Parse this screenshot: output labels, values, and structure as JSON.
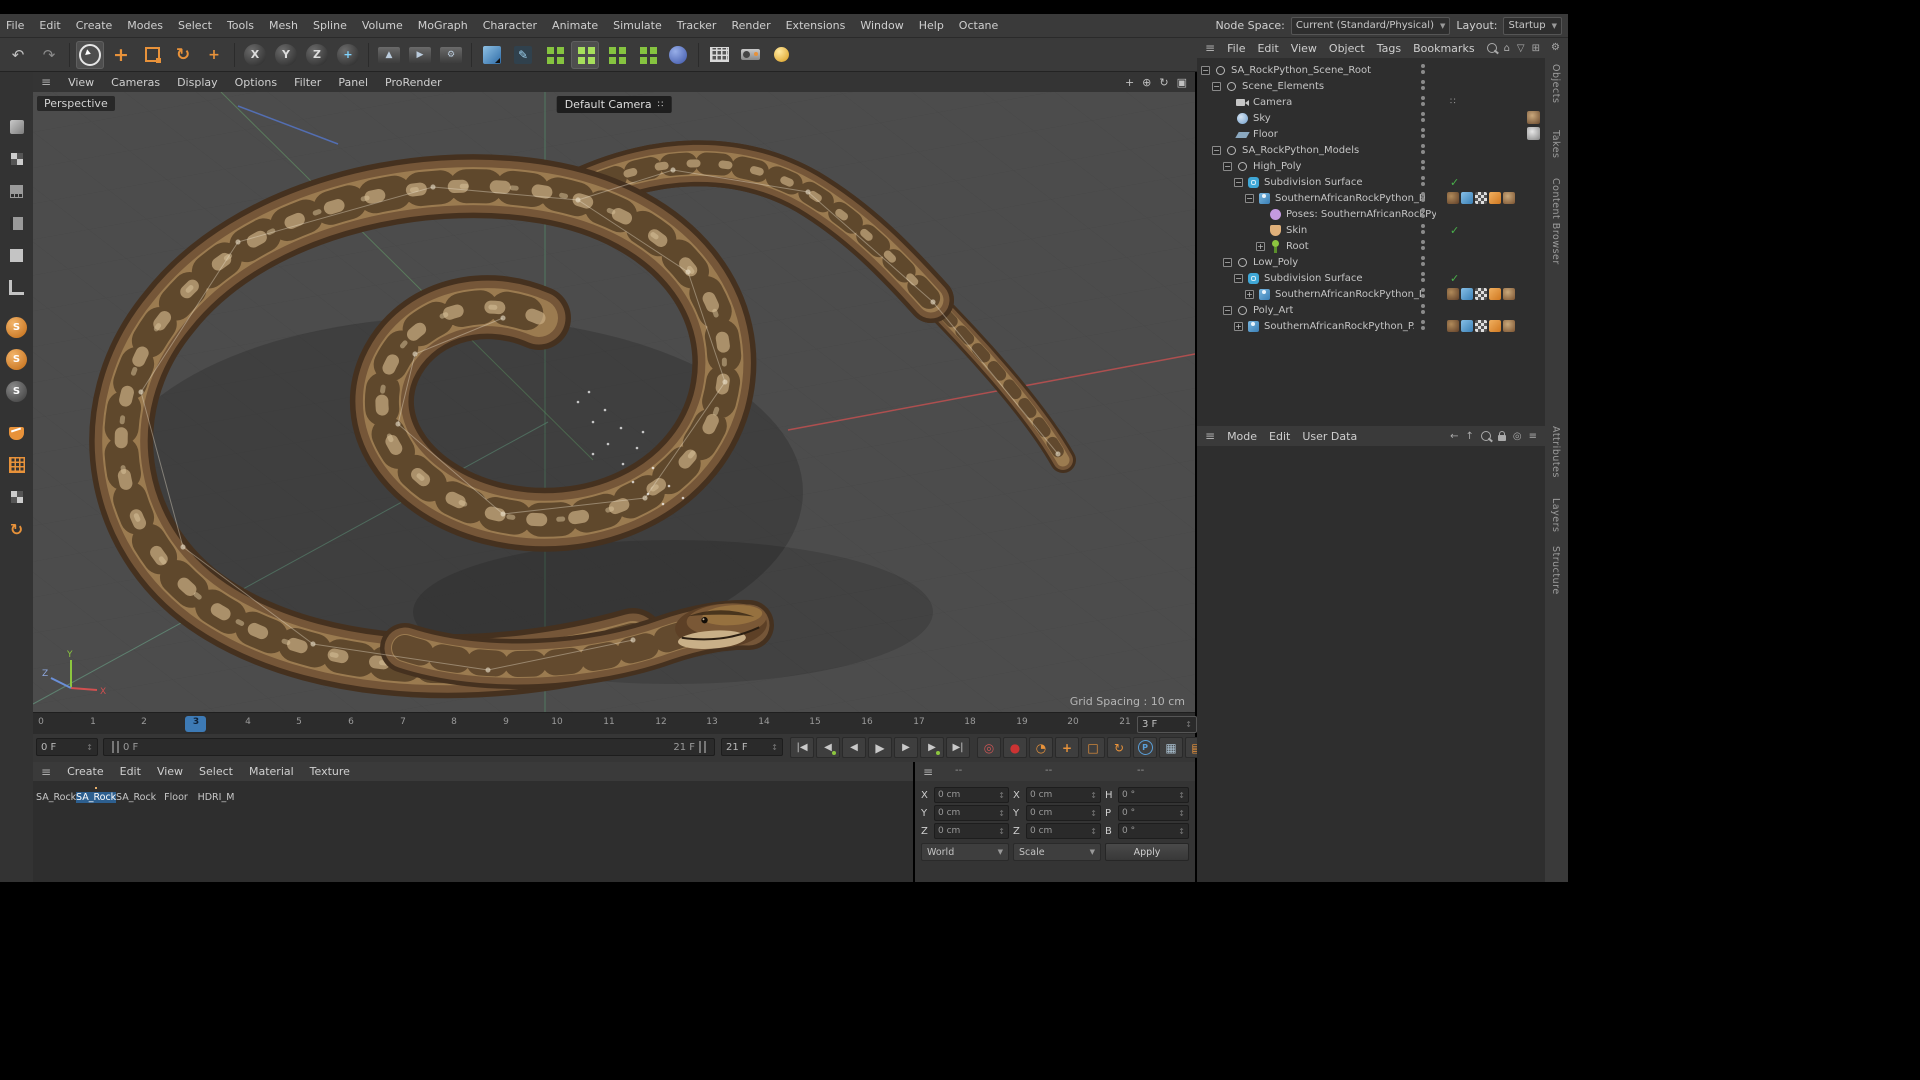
{
  "colors": {
    "accent_orange": "#e8923a",
    "accent_blue": "#4a8fd0",
    "selection_blue": "#2d5f8f",
    "check_green": "#49b04a"
  },
  "menubar": {
    "items": [
      "File",
      "Edit",
      "Create",
      "Modes",
      "Select",
      "Tools",
      "Mesh",
      "Spline",
      "Volume",
      "MoGraph",
      "Character",
      "Animate",
      "Simulate",
      "Tracker",
      "Render",
      "Extensions",
      "Window",
      "Help",
      "Octane"
    ],
    "node_space_label": "Node Space:",
    "node_space_value": "Current (Standard/Physical)",
    "layout_label": "Layout:",
    "layout_value": "Startup"
  },
  "toolbar": {
    "axis_x": "X",
    "axis_y": "Y",
    "axis_z": "Z"
  },
  "viewport": {
    "menu": [
      "View",
      "Cameras",
      "Display",
      "Options",
      "Filter",
      "Panel",
      "ProRender"
    ],
    "view_label": "Perspective",
    "camera_label": "Default Camera",
    "grid_spacing": "Grid Spacing : 10 cm",
    "axis_x": "X",
    "axis_y": "Y",
    "axis_z": "Z"
  },
  "timeline": {
    "ticks": [
      "0",
      "1",
      "2",
      "3",
      "4",
      "5",
      "6",
      "7",
      "8",
      "9",
      "10",
      "11",
      "12",
      "13",
      "14",
      "15",
      "16",
      "17",
      "18",
      "19",
      "20",
      "21"
    ],
    "frame_field": "3 F",
    "start_field": "0 F",
    "range_start": "0 F",
    "range_end": "21 F",
    "end_field": "21 F"
  },
  "materials": {
    "menu": [
      "Create",
      "Edit",
      "View",
      "Select",
      "Material",
      "Texture"
    ],
    "items": [
      {
        "label": "SA_Rock"
      },
      {
        "label": "SA_Rock"
      },
      {
        "label": "SA_Rock"
      },
      {
        "label": "Floor"
      },
      {
        "label": "HDRI_M"
      }
    ]
  },
  "coordinates": {
    "headers": [
      "--",
      "--",
      "--"
    ],
    "position_labels": [
      "X",
      "Y",
      "Z"
    ],
    "position_values": [
      "0 cm",
      "0 cm",
      "0 cm"
    ],
    "size_labels": [
      "X",
      "Y",
      "Z"
    ],
    "size_values": [
      "0 cm",
      "0 cm",
      "0 cm"
    ],
    "rotation_labels": [
      "H",
      "P",
      "B"
    ],
    "rotation_values": [
      "0 °",
      "0 °",
      "0 °"
    ],
    "position_mode": "World",
    "size_mode": "Scale",
    "apply_label": "Apply"
  },
  "object_manager": {
    "menu": [
      "File",
      "Edit",
      "View",
      "Object",
      "Tags",
      "Bookmarks"
    ],
    "tree": [
      {
        "label": "SA_RockPython_Scene_Root"
      },
      {
        "label": "Scene_Elements"
      },
      {
        "label": "Camera"
      },
      {
        "label": "Sky"
      },
      {
        "label": "Floor"
      },
      {
        "label": "SA_RockPython_Models"
      },
      {
        "label": "High_Poly"
      },
      {
        "label": "Subdivision Surface"
      },
      {
        "label": "SouthernAfricanRockPython_HP"
      },
      {
        "label": "Poses: SouthernAfricanRockPython"
      },
      {
        "label": "Skin"
      },
      {
        "label": "Root"
      },
      {
        "label": "Low_Poly"
      },
      {
        "label": "Subdivision Surface"
      },
      {
        "label": "SouthernAfricanRockPython_LP"
      },
      {
        "label": "Poly_Art"
      },
      {
        "label": "SouthernAfricanRockPython_PA"
      }
    ]
  },
  "attributes": {
    "menu": [
      "Mode",
      "Edit",
      "User Data"
    ]
  },
  "right_dock": {
    "tabs": [
      "Objects",
      "Takes",
      "Content Browser",
      "Attributes",
      "Layers",
      "Structure"
    ]
  },
  "icons": {
    "hamburger": "≡",
    "undo": "↶",
    "redo": "↷",
    "move": "+",
    "rotate": "↻",
    "dropdown": "▼",
    "check": "✓",
    "minus": "−",
    "plus": "+",
    "gear": "⚙",
    "pen": "✎",
    "play": "▶",
    "step_back": "◀",
    "step_fwd": "▶",
    "goto_start": "|◀",
    "goto_end": "▶|",
    "record_ring": "◎",
    "record": "●",
    "clock": "◔",
    "param": "P",
    "vp_pan": "+",
    "vp_zoom": "⊕",
    "vp_rotate": "↻",
    "vp_toggle": "▣",
    "arrow_left": "←",
    "arrow_up": "↑",
    "house": "⌂",
    "funnel": "▽",
    "grid": "⊞",
    "cells": "∷",
    "s_letter": "S",
    "spin": "↕",
    "bars": "▤",
    "grid2": "▦",
    "box": "□"
  }
}
